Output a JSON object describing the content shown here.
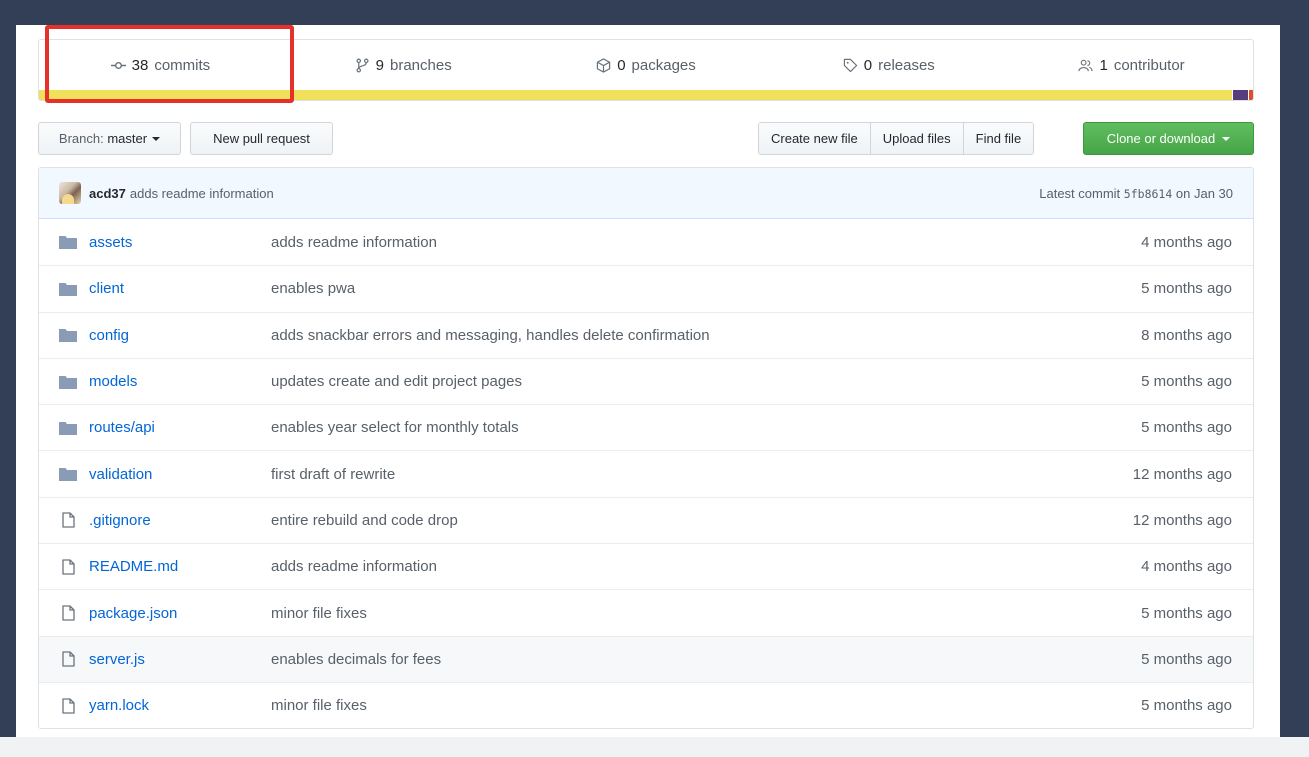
{
  "summary": {
    "items": [
      {
        "icon": "commit-icon",
        "count": "38",
        "label": "commits"
      },
      {
        "icon": "branch-icon",
        "count": "9",
        "label": "branches"
      },
      {
        "icon": "package-icon",
        "count": "0",
        "label": "packages"
      },
      {
        "icon": "tag-icon",
        "count": "0",
        "label": "releases"
      },
      {
        "icon": "people-icon",
        "count": "1",
        "label": "contributor"
      }
    ],
    "languages": [
      {
        "color": "#f1e05a",
        "percent": 98.4
      },
      {
        "color": "#563d7c",
        "percent": 1.3
      },
      {
        "color": "#e34c26",
        "percent": 0.3
      }
    ]
  },
  "annotation": {
    "highlight_color": "#e4312b",
    "target": "commits"
  },
  "toolbar": {
    "branch_prefix": "Branch:",
    "branch_name": "master",
    "new_pr_label": "New pull request",
    "create_file_label": "Create new file",
    "upload_label": "Upload files",
    "find_label": "Find file",
    "clone_label": "Clone or download"
  },
  "latest_commit": {
    "author": "acd37",
    "message": "adds readme information",
    "prefix": "Latest commit",
    "sha": "5fb8614",
    "date_text": "on Jan 30"
  },
  "files": [
    {
      "type": "dir",
      "name": "assets",
      "message": "adds readme information",
      "age": "4 months ago"
    },
    {
      "type": "dir",
      "name": "client",
      "message": "enables pwa",
      "age": "5 months ago"
    },
    {
      "type": "dir",
      "name": "config",
      "message": "adds snackbar errors and messaging, handles delete confirmation",
      "age": "8 months ago"
    },
    {
      "type": "dir",
      "name": "models",
      "message": "updates create and edit project pages",
      "age": "5 months ago"
    },
    {
      "type": "dir",
      "name": "routes/api",
      "message": "enables year select for monthly totals",
      "age": "5 months ago"
    },
    {
      "type": "dir",
      "name": "validation",
      "message": "first draft of rewrite",
      "age": "12 months ago"
    },
    {
      "type": "file",
      "name": ".gitignore",
      "message": "entire rebuild and code drop",
      "age": "12 months ago"
    },
    {
      "type": "file",
      "name": "README.md",
      "message": "adds readme information",
      "age": "4 months ago"
    },
    {
      "type": "file",
      "name": "package.json",
      "message": "minor file fixes",
      "age": "5 months ago"
    },
    {
      "type": "file",
      "name": "server.js",
      "message": "enables decimals for fees",
      "age": "5 months ago",
      "hovered": true
    },
    {
      "type": "file",
      "name": "yarn.lock",
      "message": "minor file fixes",
      "age": "5 months ago"
    }
  ]
}
